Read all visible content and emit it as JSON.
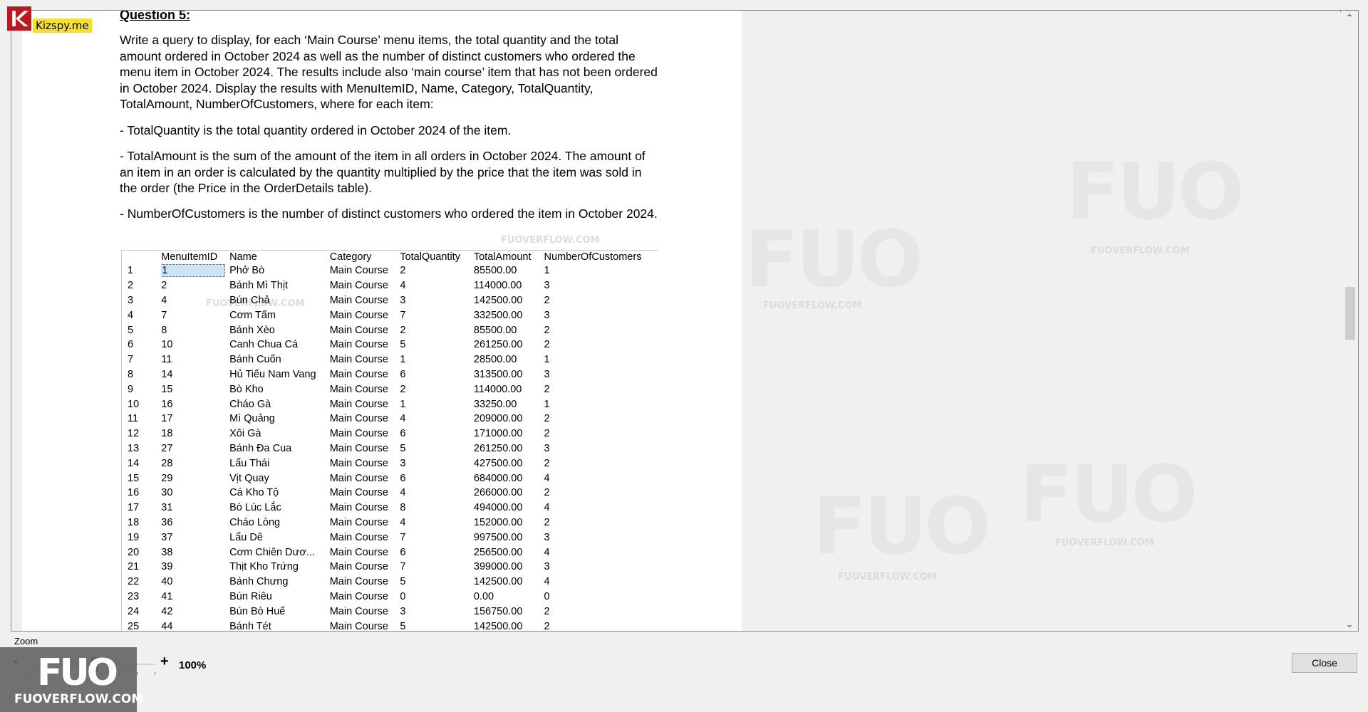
{
  "question": {
    "heading": "Question 5:",
    "paragraphs": [
      "Write a query to display, for each ‘Main Course’ menu items, the total quantity and the total amount ordered in October 2024 as well as the number of distinct customers who ordered the menu item in October 2024. The results include also ‘main course’ item that has not been ordered in October 2024. Display the results with MenuItemID, Name, Category, TotalQuantity, TotalAmount, NumberOfCustomers, where for each item:",
      "- TotalQuantity is the total quantity ordered in October 2024 of the item.",
      "- TotalAmount is the sum of the amount of the item in all orders in October 2024. The amount of an item in an order is calculated by the quantity multiplied by the price that the item was sold in the order (the Price in the OrderDetails table).",
      "- NumberOfCustomers is the number of distinct customers who ordered the item in October 2024."
    ]
  },
  "results": {
    "columns": [
      "",
      "MenuItemID",
      "Name",
      "Category",
      "TotalQuantity",
      "TotalAmount",
      "NumberOfCustomers"
    ],
    "rows": [
      [
        "1",
        "1",
        "Phở Bò",
        "Main Course",
        "2",
        "85500.00",
        "1"
      ],
      [
        "2",
        "2",
        "Bánh Mì Thịt",
        "Main Course",
        "4",
        "114000.00",
        "3"
      ],
      [
        "3",
        "4",
        "Bún Chả",
        "Main Course",
        "3",
        "142500.00",
        "2"
      ],
      [
        "4",
        "7",
        "Cơm Tấm",
        "Main Course",
        "7",
        "332500.00",
        "3"
      ],
      [
        "5",
        "8",
        "Bánh Xèo",
        "Main Course",
        "2",
        "85500.00",
        "2"
      ],
      [
        "6",
        "10",
        "Canh Chua Cá",
        "Main Course",
        "5",
        "261250.00",
        "2"
      ],
      [
        "7",
        "11",
        "Bánh Cuốn",
        "Main Course",
        "1",
        "28500.00",
        "1"
      ],
      [
        "8",
        "14",
        "Hủ Tiếu Nam Vang",
        "Main Course",
        "6",
        "313500.00",
        "3"
      ],
      [
        "9",
        "15",
        "Bò Kho",
        "Main Course",
        "2",
        "114000.00",
        "2"
      ],
      [
        "10",
        "16",
        "Cháo Gà",
        "Main Course",
        "1",
        "33250.00",
        "1"
      ],
      [
        "11",
        "17",
        "Mì Quảng",
        "Main Course",
        "4",
        "209000.00",
        "2"
      ],
      [
        "12",
        "18",
        "Xôi Gà",
        "Main Course",
        "6",
        "171000.00",
        "2"
      ],
      [
        "13",
        "27",
        "Bánh Đa Cua",
        "Main Course",
        "5",
        "261250.00",
        "3"
      ],
      [
        "14",
        "28",
        "Lẩu Thái",
        "Main Course",
        "3",
        "427500.00",
        "2"
      ],
      [
        "15",
        "29",
        "Vịt Quay",
        "Main Course",
        "6",
        "684000.00",
        "4"
      ],
      [
        "16",
        "30",
        "Cá Kho Tộ",
        "Main Course",
        "4",
        "266000.00",
        "2"
      ],
      [
        "17",
        "31",
        "Bò Lúc Lắc",
        "Main Course",
        "8",
        "494000.00",
        "4"
      ],
      [
        "18",
        "36",
        "Cháo Lòng",
        "Main Course",
        "4",
        "152000.00",
        "2"
      ],
      [
        "19",
        "37",
        "Lẩu Dê",
        "Main Course",
        "7",
        "997500.00",
        "3"
      ],
      [
        "20",
        "38",
        "Cơm Chiên Dươ...",
        "Main Course",
        "6",
        "256500.00",
        "4"
      ],
      [
        "21",
        "39",
        "Thịt Kho Trứng",
        "Main Course",
        "7",
        "399000.00",
        "3"
      ],
      [
        "22",
        "40",
        "Bánh Chưng",
        "Main Course",
        "5",
        "142500.00",
        "4"
      ],
      [
        "23",
        "41",
        "Bún Riêu",
        "Main Course",
        "0",
        "0.00",
        "0"
      ],
      [
        "24",
        "42",
        "Bún Bò Huế",
        "Main Course",
        "3",
        "156750.00",
        "2"
      ],
      [
        "25",
        "44",
        "Bánh Tét",
        "Main Course",
        "5",
        "142500.00",
        "2"
      ]
    ]
  },
  "watermark": {
    "big": "FUO",
    "small": "FUOVERFLOW.COM"
  },
  "brand": {
    "kizspy": "Kizspy.me",
    "fuo_logo": "FUO",
    "fuo_site": "FUOVERFLOW.COM"
  },
  "zoom": {
    "label": "Zoom",
    "minus": "-",
    "plus": "+",
    "value": "100%"
  },
  "close_label": "Close",
  "colors": {
    "kizspy_red": "#c0171f",
    "kizspy_yellow": "#f5e12a",
    "selection": "#cce4f7",
    "slider_thumb": "#2a76c6"
  }
}
